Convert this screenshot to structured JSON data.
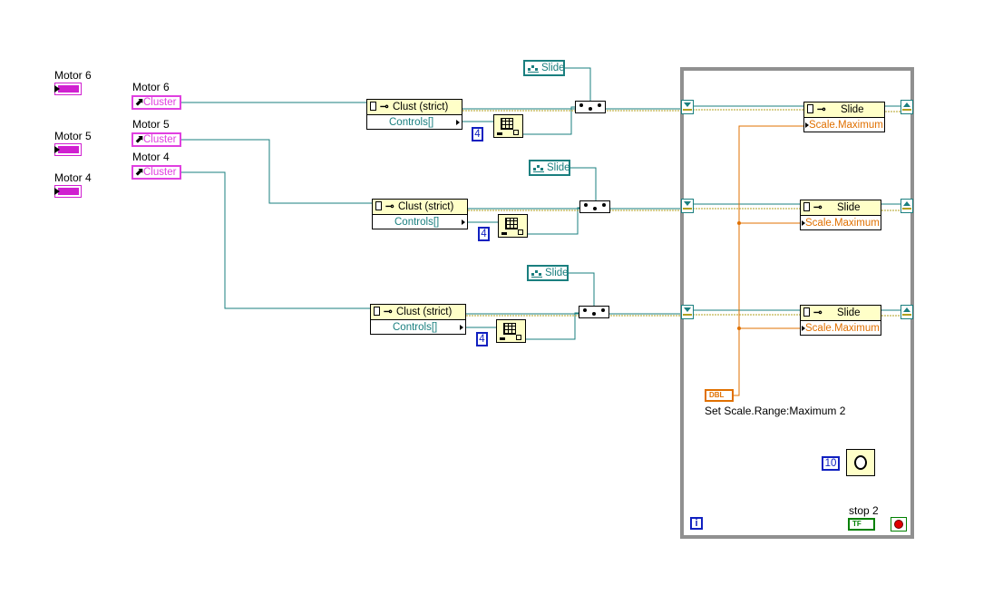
{
  "motor_indicators": [
    {
      "label": "Motor 6"
    },
    {
      "label": "Motor 5"
    },
    {
      "label": "Motor 4"
    }
  ],
  "cluster_refs": [
    {
      "label": "Motor 6",
      "terminal": "Cluster"
    },
    {
      "label": "Motor 5",
      "terminal": "Cluster"
    },
    {
      "label": "Motor 4",
      "terminal": "Cluster"
    }
  ],
  "cluster_property_nodes": [
    {
      "class": "Clust (strict)",
      "property": "Controls[]"
    },
    {
      "class": "Clust (strict)",
      "property": "Controls[]"
    },
    {
      "class": "Clust (strict)",
      "property": "Controls[]"
    }
  ],
  "index_constants": [
    "4",
    "4",
    "4"
  ],
  "slide_constants": [
    "Slide",
    "Slide",
    "Slide"
  ],
  "slide_property_nodes": [
    {
      "class": "Slide",
      "property": "Scale.Maximum"
    },
    {
      "class": "Slide",
      "property": "Scale.Maximum"
    },
    {
      "class": "Slide",
      "property": "Scale.Maximum"
    }
  ],
  "loop": {
    "dbl_control": "DBL",
    "dbl_label": "Set Scale.Range:Maximum 2",
    "wait_ms": "10",
    "iteration_terminal": "i",
    "stop_label": "stop 2",
    "stop_terminal": "TF"
  },
  "colors": {
    "ref_wire": "#1a7f7f",
    "cluster_ref": "#e040e0",
    "dbl_wire": "#e07000",
    "loop_border": "#909090",
    "numeric": "#1020c0"
  }
}
